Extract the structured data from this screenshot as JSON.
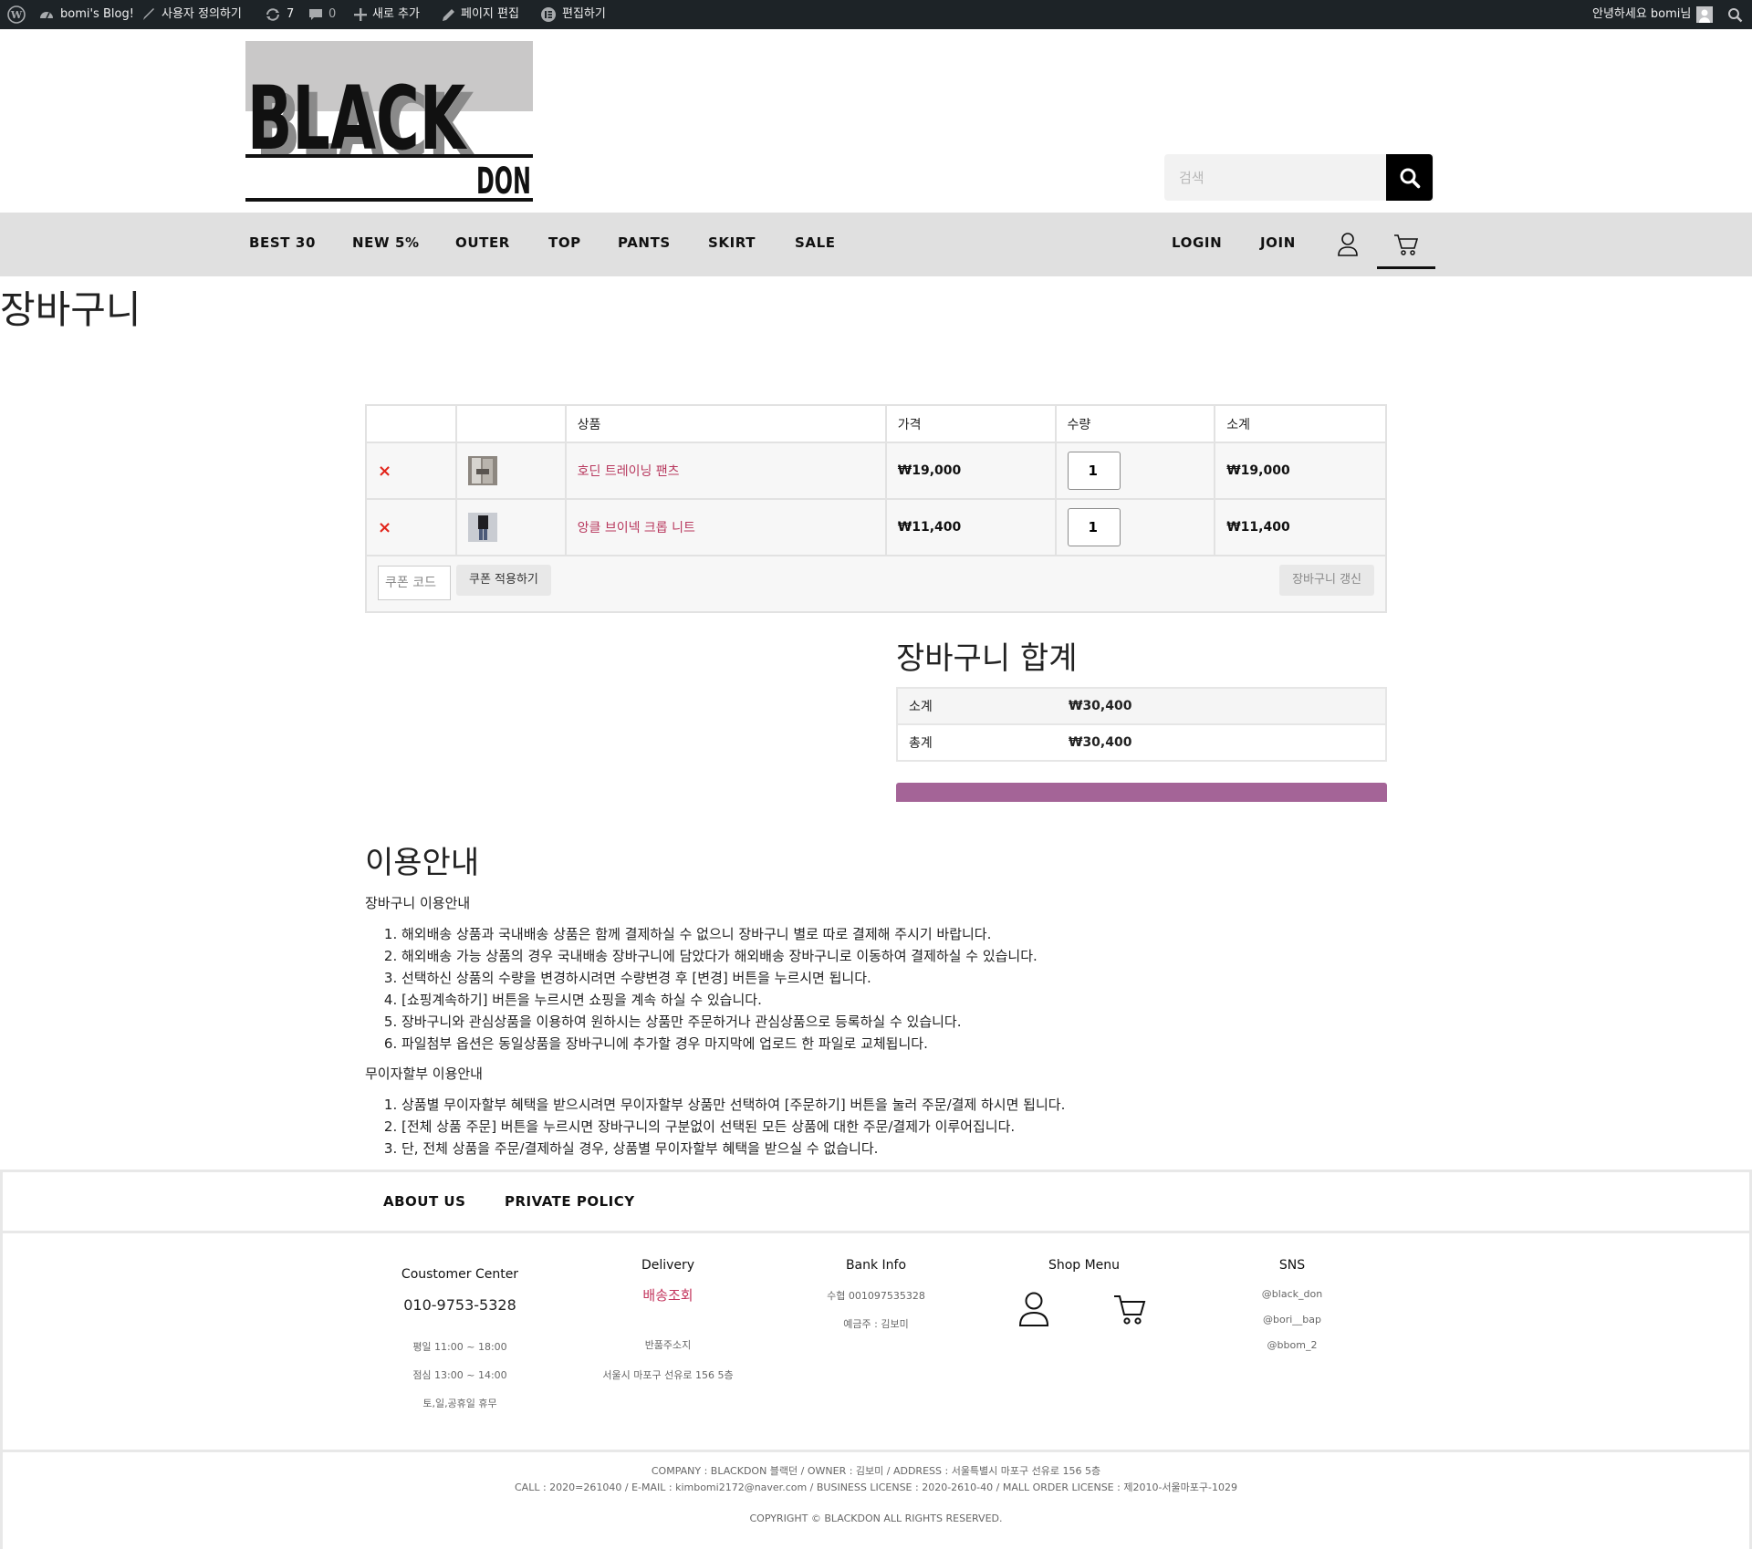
{
  "admin_bar": {
    "site_name": "bomi's Blog!",
    "customize": "사용자 정의하기",
    "updates_count": "7",
    "comments_count": "0",
    "new": "새로 추가",
    "edit_page": "페이지 편집",
    "edit_with": "편집하기",
    "greeting": "안녕하세요 bomi님"
  },
  "logo": {
    "top": "BLACK",
    "bottom": "DON"
  },
  "search": {
    "placeholder": "검색"
  },
  "nav": {
    "items": [
      "BEST 30",
      "NEW 5%",
      "OUTER",
      "TOP",
      "PANTS",
      "SKIRT",
      "SALE"
    ],
    "login": "LOGIN",
    "join": "JOIN"
  },
  "page_title": "장바구니",
  "cart": {
    "headers": [
      "",
      "",
      "상품",
      "가격",
      "수량",
      "소계"
    ],
    "rows": [
      {
        "name": "호딘 트레이닝 팬츠",
        "price": "₩19,000",
        "qty": "1",
        "subtotal": "₩19,000"
      },
      {
        "name": "앙클 브이넥 크롭 니트",
        "price": "₩11,400",
        "qty": "1",
        "subtotal": "₩11,400"
      }
    ],
    "coupon_placeholder": "쿠폰 코드",
    "apply_coupon": "쿠폰 적용하기",
    "update_cart": "장바구니 갱신"
  },
  "totals": {
    "title": "장바구니 합계",
    "subtotal_label": "소계",
    "subtotal_value": "₩30,400",
    "total_label": "총계",
    "total_value": "₩30,400",
    "checkout_color": "#a46497"
  },
  "guide": {
    "title": "이용안내",
    "cart_subtitle": "장바구니 이용안내",
    "cart_items": [
      "해외배송 상품과 국내배송 상품은 함께 결제하실 수 없으니 장바구니 별로 따로 결제해 주시기 바랍니다.",
      "해외배송 가능 상품의 경우 국내배송 장바구니에 담았다가 해외배송 장바구니로 이동하여 결제하실 수 있습니다.",
      "선택하신 상품의 수량을 변경하시려면 수량변경 후 [변경] 버튼을 누르시면 됩니다.",
      "[쇼핑계속하기] 버튼을 누르시면 쇼핑을 계속 하실 수 있습니다.",
      "장바구니와 관심상품을 이용하여 원하시는 상품만 주문하거나 관심상품으로 등록하실 수 있습니다.",
      "파일첨부 옵션은 동일상품을 장바구니에 추가할 경우 마지막에 업로드 한 파일로 교체됩니다."
    ],
    "installment_subtitle": "무이자할부 이용안내",
    "installment_items": [
      "상품별 무이자할부 혜택을 받으시려면 무이자할부 상품만 선택하여 [주문하기] 버튼을 눌러 주문/결제 하시면 됩니다.",
      "[전체 상품 주문] 버튼을 누르시면 장바구니의 구분없이 선택된 모든 상품에 대한 주문/결제가 이루어집니다.",
      "단, 전체 상품을 주문/결제하실 경우, 상품별 무이자할부 혜택을 받으실 수 없습니다."
    ]
  },
  "footer": {
    "about": "ABOUT US",
    "policy": "PRIVATE POLICY",
    "customer_center": {
      "title": "Coustomer Center",
      "phone": "010-9753-5328",
      "hours": "평일 11:00 ~ 18:00",
      "lunch": "점심 13:00 ~ 14:00",
      "closed": "토,일,공휴일 휴무"
    },
    "delivery": {
      "title": "Delivery",
      "tracking": "배송조회",
      "return_label": "반품주소지",
      "return_address": "서울시 마포구 선유로 156 5층"
    },
    "bank": {
      "title": "Bank Info",
      "account": "수협 001097535328",
      "holder": "예금주 : 김보미"
    },
    "shop_menu": {
      "title": "Shop Menu"
    },
    "sns": {
      "title": "SNS",
      "accounts": [
        "@black_don",
        "@bori__bap",
        "@bbom_2"
      ]
    },
    "company_line1": "COMPANY : BLACKDON 블랙던 / OWNER : 김보미 / ADDRESS : 서울특별시 마포구 선유로 156 5층",
    "company_line2": "CALL : 2020=261040 / E-MAIL : kimbomi2172@naver.com / BUSINESS LICENSE : 2020-2610-40 / MALL ORDER LICENSE : 제2010-서울마포구-1029",
    "copyright": "COPYRIGHT © BLACKDON ALL RIGHTS RESERVED."
  }
}
